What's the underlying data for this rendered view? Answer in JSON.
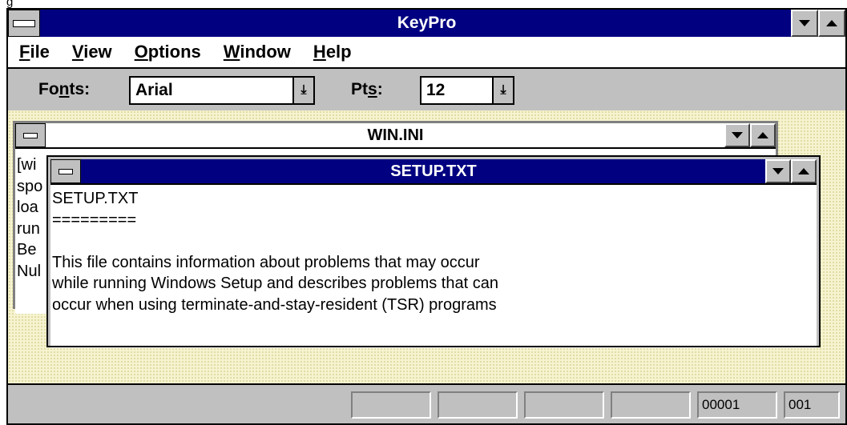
{
  "top_fragment": "g",
  "app": {
    "title": "KeyPro"
  },
  "menu": {
    "items": [
      {
        "label": "File",
        "mnemonic": "F"
      },
      {
        "label": "View",
        "mnemonic": "V"
      },
      {
        "label": "Options",
        "mnemonic": "O"
      },
      {
        "label": "Window",
        "mnemonic": "W"
      },
      {
        "label": "Help",
        "mnemonic": "H"
      }
    ]
  },
  "toolbar": {
    "fonts_label": "Fonts:",
    "font_value": "Arial",
    "pts_label": "Pts:",
    "pts_value": "12"
  },
  "windows": {
    "win_ini": {
      "title": "WIN.INI",
      "visible_line_fragments": [
        "[wi",
        "spo",
        "loa",
        "run",
        "Be",
        "Nul"
      ]
    },
    "setup_txt": {
      "title": "SETUP.TXT",
      "lines": [
        "SETUP.TXT",
        "=========",
        "",
        "This file contains information about problems that may occur",
        "while running Windows Setup and describes problems that can",
        "occur when using terminate-and-stay-resident (TSR) programs"
      ]
    }
  },
  "status": {
    "line": "00001",
    "col": "001"
  },
  "colors": {
    "active_title": "#000080",
    "face": "#c0c0c0",
    "workspace": "#f6f3cf"
  }
}
